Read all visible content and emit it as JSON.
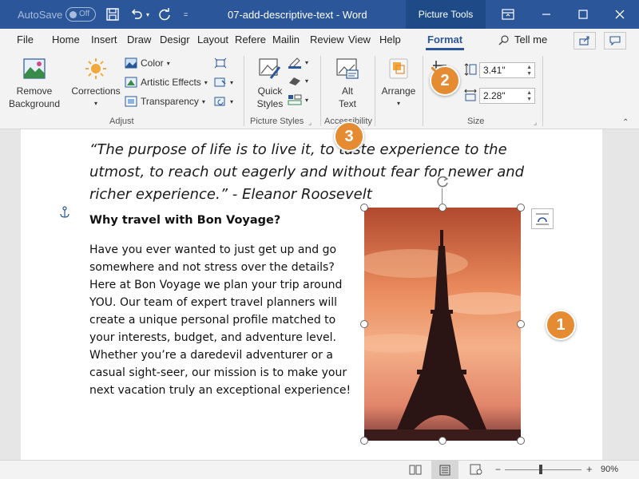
{
  "titlebar": {
    "autosave_label": "AutoSave",
    "autosave_state": "Off",
    "document_title": "07-add-descriptive-text - Word",
    "context_tab": "Picture Tools"
  },
  "tabs": [
    "File",
    "Home",
    "Insert",
    "Draw",
    "Desigr",
    "Layout",
    "Refere",
    "Mailin",
    "Review",
    "View",
    "Help",
    "Format"
  ],
  "tell_me": "Tell me",
  "ribbon": {
    "remove_background": [
      "Remove",
      "Background"
    ],
    "corrections": "Corrections",
    "color": "Color",
    "artistic_effects": "Artistic Effects",
    "transparency": "Transparency",
    "quick_styles": [
      "Quick",
      "Styles"
    ],
    "alt_text": [
      "Alt",
      "Text"
    ],
    "arrange": "Arrange",
    "height_value": "3.41\"",
    "width_value": "2.28\"",
    "groups": {
      "adjust": "Adjust",
      "picture_styles": "Picture Styles",
      "accessibility": "Accessibility",
      "size": "Size"
    }
  },
  "document": {
    "quote": "“The purpose of life is to live it, to taste experience to the utmost, to reach out eagerly and without fear for newer and richer experience.” - Eleanor Roosevelt",
    "heading": "Why travel with Bon Voyage?",
    "body": "Have you ever wanted to just get up and go somewhere and not stress over the details? Here at Bon Voyage we plan your trip around YOU. Our team of expert travel planners will create a unique personal profile matched to your interests, budget, and adventure level. Whether you’re a daredevil adventurer or a casual sight-seer, our mission is to make your next vacation truly an exceptional experience!"
  },
  "callouts": [
    "1",
    "2",
    "3"
  ],
  "statusbar": {
    "zoom": "90%"
  },
  "colors": {
    "accent": "#2b579a",
    "callout": "#e58b32"
  }
}
